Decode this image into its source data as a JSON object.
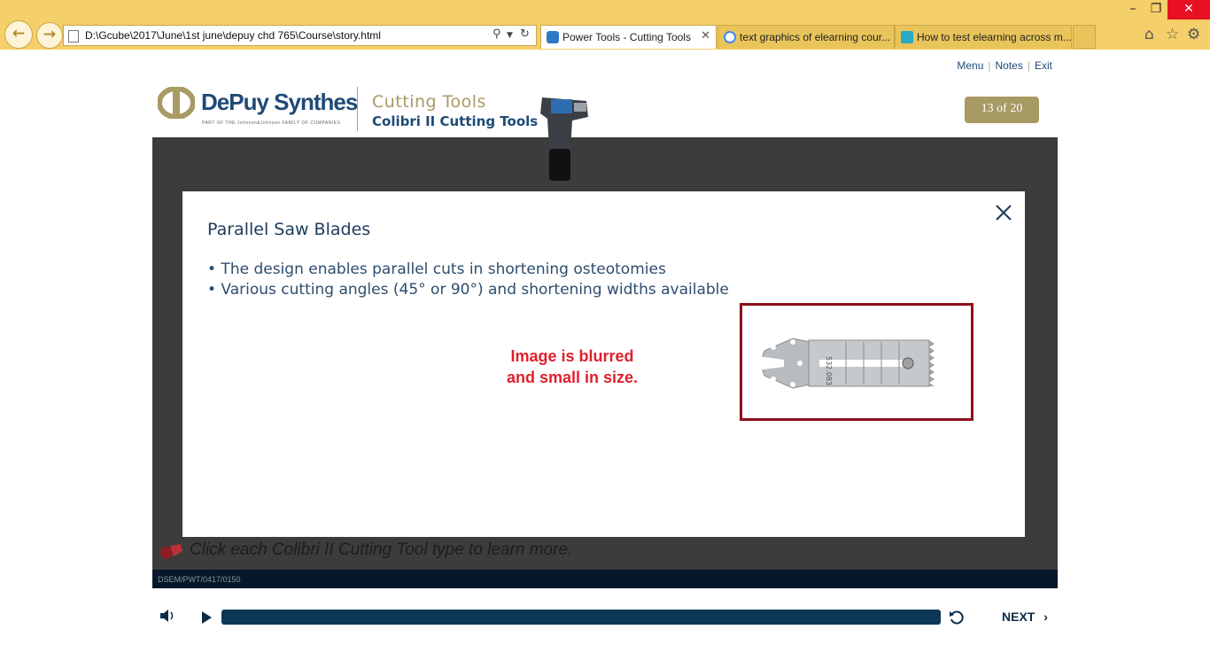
{
  "browser": {
    "window_controls": {
      "minimize": "–",
      "restore": "❐",
      "close": "✕"
    },
    "address_url": "D:\\Gcube\\2017\\June\\1st june\\depuy chd 765\\Course\\story.html",
    "tabs": [
      {
        "label": "Power Tools - Cutting Tools",
        "close": "✕",
        "icon": "ie-page-icon"
      },
      {
        "label": "text graphics of elearning cour...",
        "icon": "google-icon"
      },
      {
        "label": "How to test elearning across m...",
        "icon": "tz-icon"
      }
    ],
    "tools": {
      "home": "⌂",
      "favorites": "☆",
      "settings": "⚙"
    }
  },
  "header": {
    "links": {
      "menu": "Menu",
      "notes": "Notes",
      "exit": "Exit"
    },
    "brand": "DePuy Synthes",
    "brand_sub": "PART OF THE Johnson&Johnson FAMILY OF COMPANIES",
    "course_title": "Cutting Tools",
    "course_subtitle": "Colibri II Cutting Tools",
    "counter": "13 of 20"
  },
  "modal": {
    "title": "Parallel Saw Blades",
    "bullets": [
      "• The design enables parallel cuts in shortening osteotomies",
      "• Various cutting angles (45° or 90°) and shortening widths available"
    ],
    "review_note_line1": "Image is blurred",
    "review_note_line2": "and small in size.",
    "blade_marking": "532.083"
  },
  "stage": {
    "instruction": "Click each Colibri II Cutting Tool type to learn more.",
    "footer_code": "DSEM/PWT/0417/0150"
  },
  "player": {
    "next_label": "NEXT",
    "progress": 1.0
  },
  "colors": {
    "chrome": "#f5cf6a",
    "brand_blue": "#1f4a78",
    "gold": "#a89a63",
    "stage_bg": "#3c3c3c",
    "review_red": "#e0202d",
    "frame_red": "#8c0f1d"
  }
}
